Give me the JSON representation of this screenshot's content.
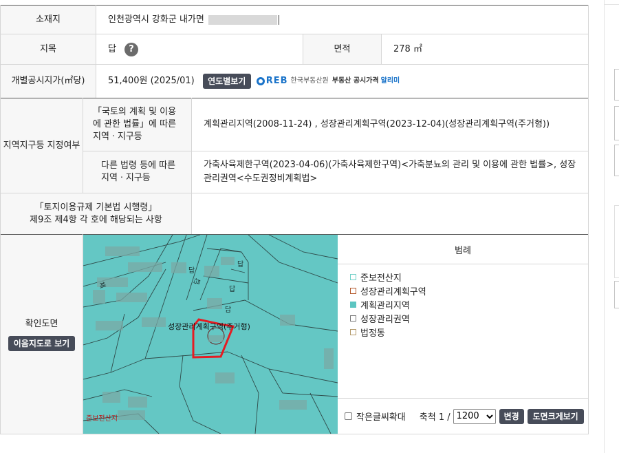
{
  "rows": {
    "location": {
      "label": "소재지",
      "value": "인천광역시 강화군 내가면"
    },
    "land_category": {
      "label": "지목",
      "value": "답",
      "help_icon": "question-circle-icon"
    },
    "area": {
      "label": "면적",
      "value": "278 ㎡"
    },
    "official_price": {
      "label": "개별공시지가(㎡당)",
      "value": "51,400원 (2025/01)",
      "yearly_button": "연도별보기",
      "reb_logo": "REB",
      "reb_org": "한국부동산원",
      "reb_service_prefix": "부동산 공시가격",
      "reb_service_suffix": "알리미"
    },
    "zoning": {
      "label": "지역지구등 지정여부",
      "sub1_label": "「국토의 계획 및 이용에 관한 법률」에 따른 지역ㆍ지구등",
      "sub1_value": "계획관리지역(2008-11-24) , 성장관리계획구역(2023-12-04)(성장관리계획구역(주거형))",
      "sub2_label": "다른 법령 등에 따른 지역ㆍ지구등",
      "sub2_value": "가축사육제한구역(2023-04-06)(가축사육제한구역)<가축분뇨의 관리 및 이용에 관한 법률>, 성장관리권역<수도권정비계획법>"
    },
    "enforcement": {
      "label_line1": "「토지이용규제 기본법 시행령」",
      "label_line2": "제9조 제4항 각 호에 해당되는 사항",
      "value": ""
    },
    "confirm_map": {
      "label": "확인도면",
      "button": "이음지도로 보기"
    }
  },
  "map": {
    "parcel_labels": [
      "답",
      "답",
      "답",
      "답",
      "체",
      "답"
    ],
    "zone_label": "성장관리계획구역(주거형)",
    "corner_label": "준보전산지",
    "bg_color": "#64c7c4",
    "highlight_color": "#e51c23"
  },
  "legend": {
    "title": "범례",
    "items": [
      {
        "label": "준보전산지",
        "color": "#6fd0c8",
        "fill": false
      },
      {
        "label": "성장관리계획구역",
        "color": "#b3582a",
        "fill": false
      },
      {
        "label": "계획관리지역",
        "color": "#5cc5c1",
        "fill": true
      },
      {
        "label": "성장관리권역",
        "color": "#777777",
        "fill": false
      },
      {
        "label": "법정동",
        "color": "#b39a6a",
        "fill": false
      }
    ]
  },
  "controls": {
    "small_text_zoom": "작은글씨확대",
    "scale_label": "축척 1 /",
    "scale_value": "1200",
    "scale_options": [
      "1200"
    ],
    "change_button": "변경",
    "big_view_button": "도면크게보기"
  }
}
